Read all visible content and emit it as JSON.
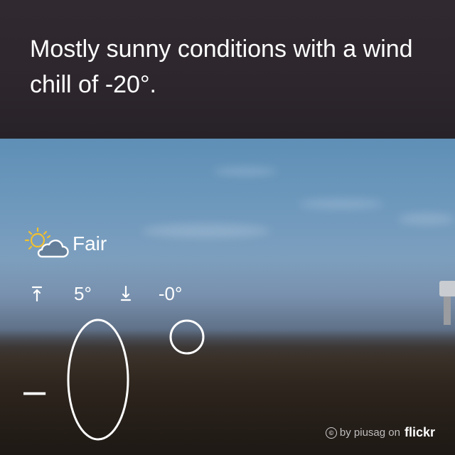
{
  "summary": {
    "text": "Mostly sunny conditions with a wind chill of -20°."
  },
  "current": {
    "condition_icon": "partly-sunny-icon",
    "condition": "Fair",
    "high_icon": "arrow-up-icon",
    "high": "5°",
    "low_icon": "arrow-down-icon",
    "low": "-0°",
    "temperature_sign": "–",
    "temperature_digit": "0",
    "degree_symbol": "°"
  },
  "photo_credit": {
    "icon": "creative-commons-icon",
    "cc_glyph": "©",
    "by_text": "by piusag on",
    "brand": "flickr"
  },
  "colors": {
    "header_bg": "#2e282e",
    "text": "#ffffff",
    "sun": "#f2c12e"
  }
}
